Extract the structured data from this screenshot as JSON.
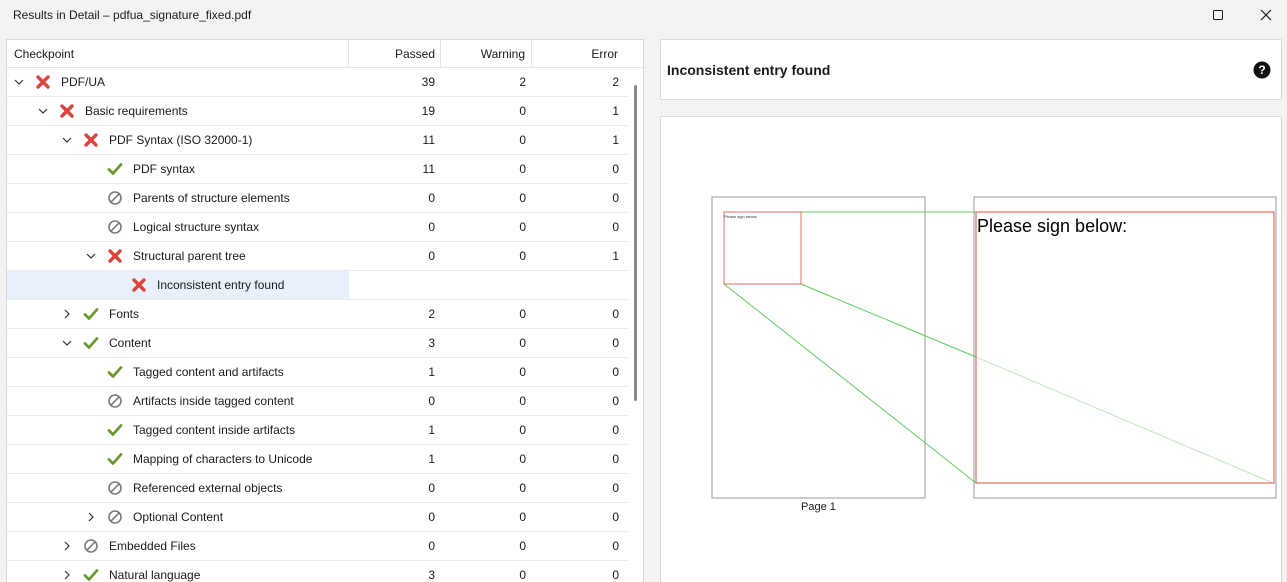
{
  "window": {
    "title": "Results in Detail – pdfua_signature_fixed.pdf"
  },
  "columns": {
    "checkpoint": "Checkpoint",
    "passed": "Passed",
    "warning": "Warning",
    "error": "Error"
  },
  "rows": [
    {
      "label": "PDF/UA",
      "level": 0,
      "expander": "expanded",
      "status": "error",
      "passed": "39",
      "warning": "2",
      "error": "2"
    },
    {
      "label": "Basic requirements",
      "level": 1,
      "expander": "expanded",
      "status": "error",
      "passed": "19",
      "warning": "0",
      "error": "1"
    },
    {
      "label": "PDF Syntax (ISO 32000-1)",
      "level": 2,
      "expander": "expanded",
      "status": "error",
      "passed": "11",
      "warning": "0",
      "error": "1"
    },
    {
      "label": "PDF syntax",
      "level": 3,
      "expander": "none",
      "status": "pass",
      "passed": "11",
      "warning": "0",
      "error": "0"
    },
    {
      "label": "Parents of structure elements",
      "level": 3,
      "expander": "none",
      "status": "na",
      "passed": "0",
      "warning": "0",
      "error": "0"
    },
    {
      "label": "Logical structure syntax",
      "level": 3,
      "expander": "none",
      "status": "na",
      "passed": "0",
      "warning": "0",
      "error": "0"
    },
    {
      "label": "Structural parent tree",
      "level": 3,
      "expander": "expanded",
      "status": "error",
      "passed": "0",
      "warning": "0",
      "error": "1"
    },
    {
      "label": "Inconsistent entry found",
      "level": 4,
      "expander": "none",
      "status": "error",
      "passed": "",
      "warning": "",
      "error": "",
      "selected": true
    },
    {
      "label": "Fonts",
      "level": 2,
      "expander": "collapsed",
      "status": "pass",
      "passed": "2",
      "warning": "0",
      "error": "0"
    },
    {
      "label": "Content",
      "level": 2,
      "expander": "expanded",
      "status": "pass",
      "passed": "3",
      "warning": "0",
      "error": "0"
    },
    {
      "label": "Tagged content and artifacts",
      "level": 3,
      "expander": "none",
      "status": "pass",
      "passed": "1",
      "warning": "0",
      "error": "0"
    },
    {
      "label": "Artifacts inside tagged content",
      "level": 3,
      "expander": "none",
      "status": "na",
      "passed": "0",
      "warning": "0",
      "error": "0"
    },
    {
      "label": "Tagged content inside artifacts",
      "level": 3,
      "expander": "none",
      "status": "pass",
      "passed": "1",
      "warning": "0",
      "error": "0"
    },
    {
      "label": "Mapping of characters to Unicode",
      "level": 3,
      "expander": "none",
      "status": "pass",
      "passed": "1",
      "warning": "0",
      "error": "0"
    },
    {
      "label": "Referenced external objects",
      "level": 3,
      "expander": "none",
      "status": "na",
      "passed": "0",
      "warning": "0",
      "error": "0"
    },
    {
      "label": "Optional Content",
      "level": 3,
      "expander": "collapsed",
      "status": "na",
      "passed": "0",
      "warning": "0",
      "error": "0"
    },
    {
      "label": "Embedded Files",
      "level": 2,
      "expander": "collapsed",
      "status": "na",
      "passed": "0",
      "warning": "0",
      "error": "0"
    },
    {
      "label": "Natural language",
      "level": 2,
      "expander": "collapsed",
      "status": "pass",
      "passed": "3",
      "warning": "0",
      "error": "0"
    }
  ],
  "detail": {
    "title": "Inconsistent entry found",
    "page_label": "Page 1",
    "thumb_text": "Please sign below:",
    "zoom_text": "Please sign below:"
  },
  "colors": {
    "error": "#d9443b",
    "pass": "#6a9a2c",
    "na": "#7a7a7a",
    "connector": "#5ccc5c",
    "highlight": "#e07060"
  }
}
